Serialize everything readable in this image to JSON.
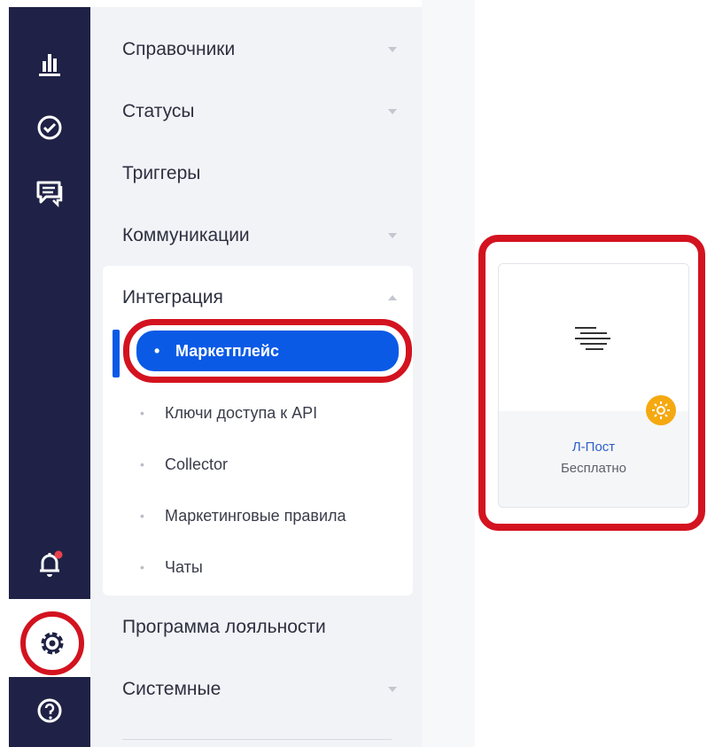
{
  "rail": {
    "icons": [
      "bar-chart-icon",
      "check-circle-icon",
      "chat-icon",
      "bell-icon",
      "gear-icon",
      "help-icon"
    ],
    "accent": "#d3131f",
    "background": "#1f2246"
  },
  "menu": {
    "items": [
      {
        "label": "Справочники"
      },
      {
        "label": "Статусы"
      },
      {
        "label": "Триггеры"
      },
      {
        "label": "Коммуникации"
      },
      {
        "label": "Интеграция"
      },
      {
        "label": "Программа лояльности"
      },
      {
        "label": "Системные"
      }
    ],
    "integration_subitems": [
      {
        "label": "Маркетплейс"
      },
      {
        "label": "Ключи доступа к API"
      },
      {
        "label": "Collector"
      },
      {
        "label": "Маркетинговые правила"
      },
      {
        "label": "Чаты"
      }
    ],
    "active_color": "#0a5ae6"
  },
  "card": {
    "name": "Л-Пост",
    "price": "Бесплатно",
    "badge_icon": "sun-icon",
    "badge_color": "#f5a911"
  }
}
